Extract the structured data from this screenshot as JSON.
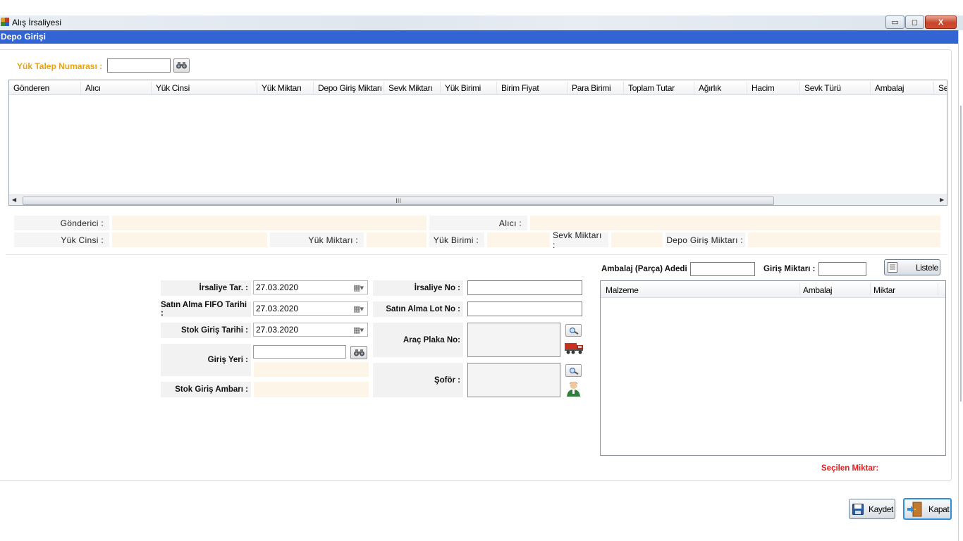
{
  "window": {
    "title": "Alış İrsaliyesi",
    "minimize_glyph": "▭",
    "maximize_glyph": "◻",
    "close_glyph": "X"
  },
  "header": {
    "section_title": "Depo Girişi"
  },
  "request": {
    "label": "Yük Talep Numarası :",
    "value": ""
  },
  "grid": {
    "columns": [
      "Gönderen",
      "Alıcı",
      "Yük Cinsi",
      "Yük Miktarı",
      "Depo Giriş Miktarı",
      "Sevk Miktarı",
      "Yük Birimi",
      "Birim Fiyat",
      "Para Birimi",
      "Toplam Tutar",
      "Ağırlık",
      "Hacim",
      "Sevk Türü",
      "Ambalaj",
      "Se"
    ],
    "rows": [],
    "scroll_grip": "III",
    "scroll_left": "◀",
    "scroll_right": "▶"
  },
  "info": {
    "gonderici_label": "Gönderici  :",
    "gonderici_value": "",
    "alici_label": "Alıcı  :",
    "alici_value": "",
    "yuk_cinsi_label": "Yük Cinsi :",
    "yuk_cinsi_value": "",
    "yuk_miktari_label": "Yük Miktarı :",
    "yuk_miktari_value": "",
    "yuk_birimi_label": "Yük Birimi :",
    "yuk_birimi_value": "",
    "sevk_miktari_label": "Sevk Miktarı :",
    "sevk_miktari_value": "",
    "depo_giris_label": "Depo Giriş Miktarı :",
    "depo_giris_value": ""
  },
  "form": {
    "irsaliye_tar_label": "İrsaliye Tar. :",
    "irsaliye_tar_value": "27.03.2020",
    "fifo_label": "Satın Alma FIFO Tarihi :",
    "fifo_value": "27.03.2020",
    "stok_giris_tarihi_label": "Stok Giriş Tarihi :",
    "stok_giris_tarihi_value": "27.03.2020",
    "giris_yeri_label": "Giriş Yeri :",
    "giris_yeri_value": "",
    "stok_ambari_label": "Stok Giriş Ambarı :",
    "stok_ambari_value": "",
    "irsaliye_no_label": "İrsaliye No :",
    "irsaliye_no_value": "",
    "lot_no_label": "Satın Alma Lot No :",
    "lot_no_value": "",
    "arac_plaka_label": "Araç Plaka No:",
    "arac_plaka_value": "",
    "sofor_label": "Şoför :",
    "sofor_value": "",
    "calendar_glyph": "▦▾"
  },
  "packaging": {
    "ambalaj_adedi_label": "Ambalaj (Parça) Adedi :",
    "ambalaj_adedi_value": "",
    "giris_miktari_label": "Giriş Miktarı :",
    "giris_miktari_value": "",
    "listele_label": "Listele",
    "columns": [
      "Malzeme",
      "Ambalaj",
      "Miktar"
    ],
    "rows": [],
    "secilen_label": "Seçilen Miktar:"
  },
  "actions": {
    "save_label": "Kaydet",
    "close_label": "Kapat"
  },
  "colors": {
    "header_blue": "#3264d4",
    "accent_orange": "#e8a317",
    "readonly_fill": "#fdf5e8",
    "alert_red": "#e02020"
  },
  "icons": [
    "app-icon",
    "binoculars-icon",
    "calendar-icon",
    "magnifier-icon",
    "truck-icon",
    "driver-icon",
    "list-icon",
    "save-icon",
    "exit-door-icon"
  ]
}
